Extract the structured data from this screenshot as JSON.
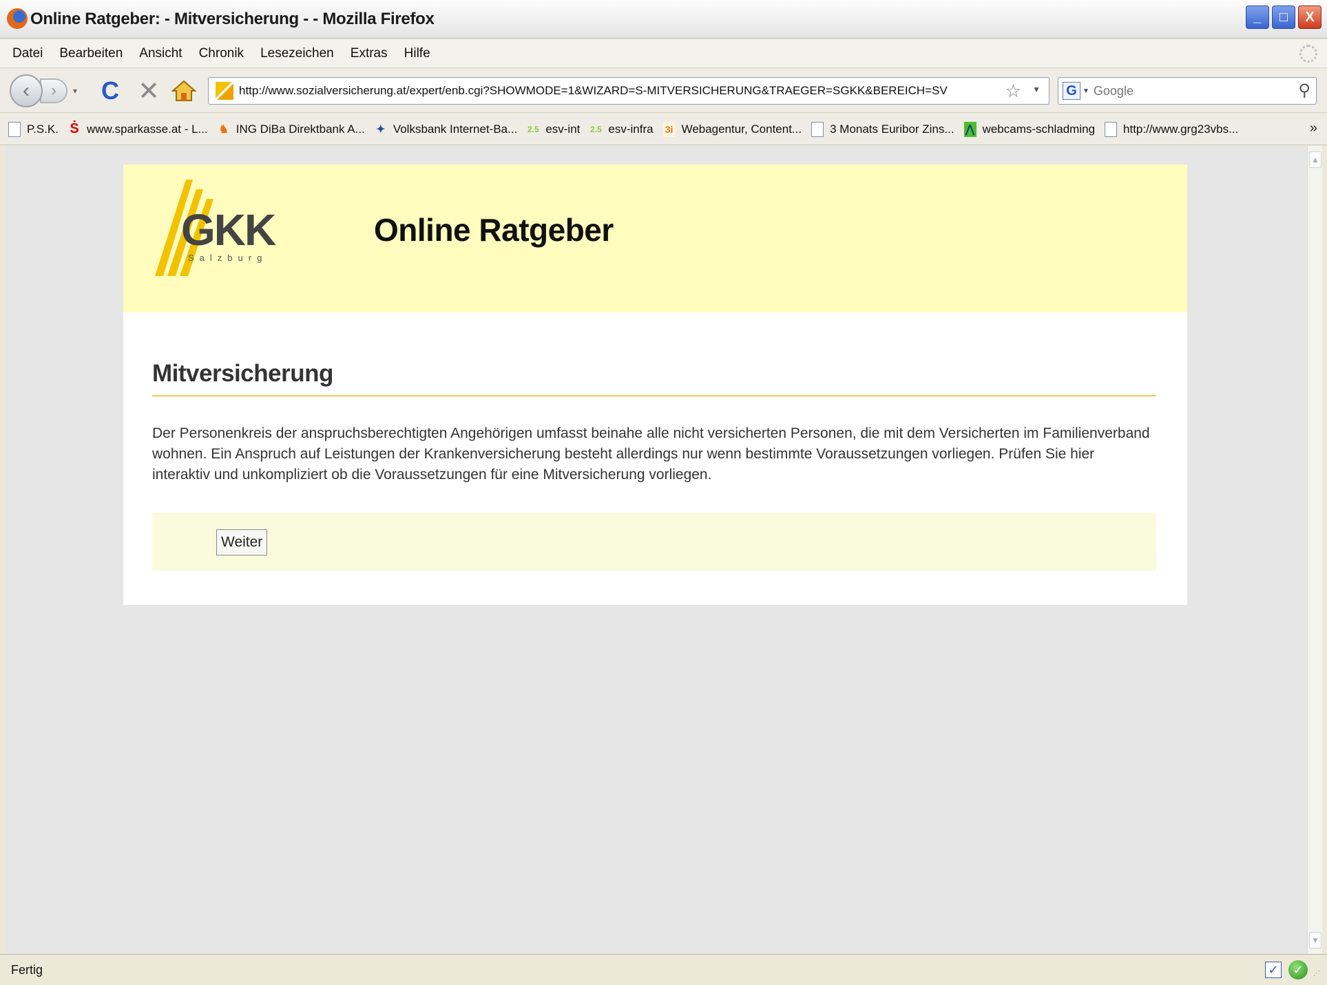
{
  "window": {
    "title": "Online Ratgeber: - Mitversicherung - - Mozilla Firefox",
    "minimize": "_",
    "maximize": "□",
    "close": "X"
  },
  "menu": {
    "items": [
      "Datei",
      "Bearbeiten",
      "Ansicht",
      "Chronik",
      "Lesezeichen",
      "Extras",
      "Hilfe"
    ]
  },
  "nav": {
    "back": "‹",
    "forward": "›",
    "reload": "C",
    "stop": "✕",
    "url": "http://www.sozialversicherung.at/expert/enb.cgi?SHOWMODE=1&WIZARD=S-MITVERSICHERUNG&TRAEGER=SGKK&BEREICH=SV",
    "search_engine": "G",
    "search_placeholder": "Google"
  },
  "bookmarks": [
    {
      "label": "P.S.K.",
      "icon": "page-icon"
    },
    {
      "label": "www.sparkasse.at - L...",
      "icon": "sparkasse-icon"
    },
    {
      "label": "ING DiBa Direktbank A...",
      "icon": "ing-lion-icon"
    },
    {
      "label": "Volksbank Internet-Ba...",
      "icon": "volksbank-icon"
    },
    {
      "label": "esv-int",
      "icon": "esv-icon"
    },
    {
      "label": "esv-infra",
      "icon": "esv-icon"
    },
    {
      "label": "Webagentur, Content...",
      "icon": "3i-icon"
    },
    {
      "label": "3 Monats Euribor Zins...",
      "icon": "page-icon"
    },
    {
      "label": "webcams-schladming",
      "icon": "webcam-icon"
    },
    {
      "label": "http://www.grg23vbs...",
      "icon": "page-icon"
    }
  ],
  "bookmarks_more": "»",
  "page": {
    "logo_text": "GKK",
    "logo_subtext": "Salzburg",
    "header_title": "Online Ratgeber",
    "section_title": "Mitversicherung",
    "intro": "Der Personenkreis der anspruchsberechtigten Angehörigen umfasst beinahe alle nicht versicherten Personen, die mit dem Versicherten im Familienverband wohnen. Ein Anspruch auf Leistungen der Krankenversicherung besteht allerdings nur wenn bestimmte Voraussetzungen vorliegen. Prüfen Sie hier interaktiv und unkompliziert ob die Voraussetzungen für eine Mitversicherung vorliegen.",
    "button_label": "Weiter"
  },
  "status": {
    "text": "Fertig"
  },
  "colors": {
    "header_bg": "#fffcbe",
    "accent_rule": "#f2c84b",
    "action_bar_bg": "#fafbdc",
    "logo_stripes": "#f2c200"
  }
}
